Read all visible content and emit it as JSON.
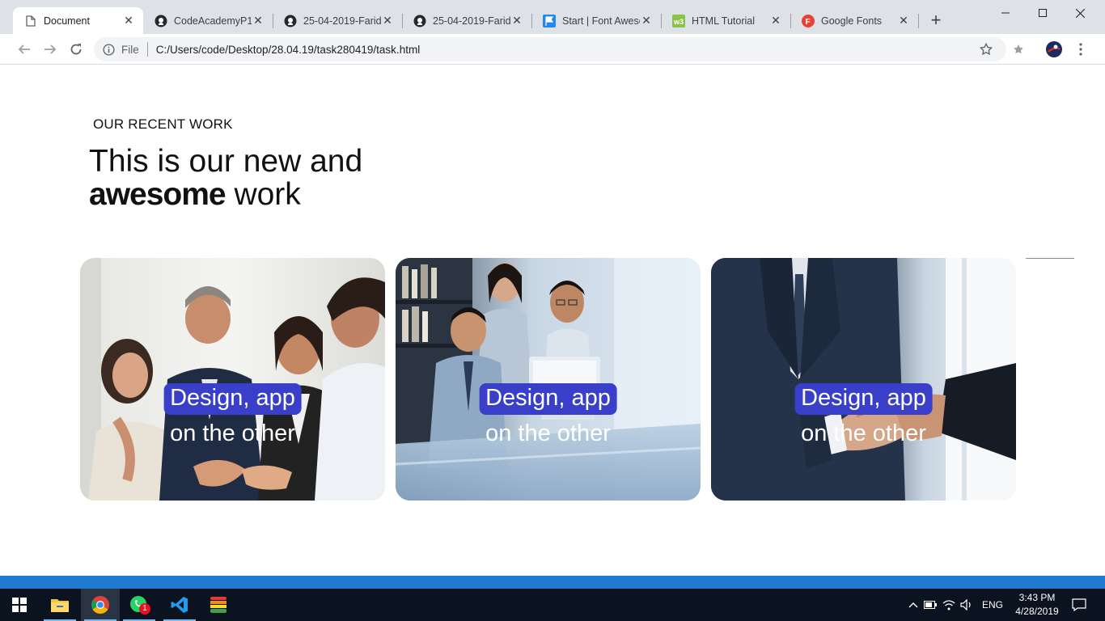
{
  "browser": {
    "tabs": [
      {
        "label": "Document",
        "icon": "document-icon",
        "active": true
      },
      {
        "label": "CodeAcademyP11",
        "icon": "github-icon"
      },
      {
        "label": "25-04-2019-Farid",
        "icon": "github-icon"
      },
      {
        "label": "25-04-2019-Farid",
        "icon": "github-icon"
      },
      {
        "label": "Start | Font Awesome",
        "icon": "flag-icon"
      },
      {
        "label": "HTML Tutorial",
        "icon": "w3schools-icon"
      },
      {
        "label": "Google Fonts",
        "icon": "google-fonts-icon"
      }
    ],
    "address": {
      "scheme": "File",
      "url": "C:/Users/code/Desktop/28.04.19/task280419/task.html"
    }
  },
  "page": {
    "eyebrow": "OUR RECENT WORK",
    "headline_line1": "This is our new and",
    "headline_bold": "awesome",
    "headline_rest": " work",
    "cards": [
      {
        "caption_line1": "Design, app",
        "caption_line2": "on the other"
      },
      {
        "caption_line1": "Design, app",
        "caption_line2": "on the other"
      },
      {
        "caption_line1": "Design, app",
        "caption_line2": "on the other"
      }
    ]
  },
  "taskbar": {
    "whatsapp_badge": "1",
    "language": "ENG",
    "time": "3:43 PM",
    "date": "4/28/2019"
  },
  "colors": {
    "caption_highlight": "#3a3fc9",
    "taskbar": "#0c1320",
    "tabstrip": "#dee1e6"
  }
}
